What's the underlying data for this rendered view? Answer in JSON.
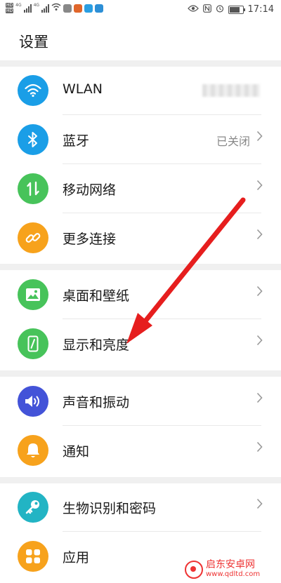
{
  "colors": {
    "wlan": "#1a9ee7",
    "bluetooth": "#1a9ee7",
    "mobile": "#47c35a",
    "more": "#f7a21c",
    "wallpaper": "#47c35a",
    "display": "#47c35a",
    "sound": "#4353d8",
    "notify": "#f7a21c",
    "bio": "#22b4c4",
    "apps": "#f7a21c",
    "arrow": "#e61e1e"
  },
  "status": {
    "hd1": "HD",
    "hd2": "HD",
    "gen1": "4G",
    "gen2": "4G",
    "time": "17:14",
    "battery_level": 0.85
  },
  "page": {
    "title": "设置"
  },
  "rows": [
    {
      "label": "WLAN",
      "value": "",
      "icon": "wifi-icon"
    },
    {
      "label": "蓝牙",
      "value": "已关闭",
      "icon": "bluetooth-icon"
    },
    {
      "label": "移动网络",
      "value": "",
      "icon": "mobile-data-icon"
    },
    {
      "label": "更多连接",
      "value": "",
      "icon": "link-icon"
    },
    {
      "label": "桌面和壁纸",
      "value": "",
      "icon": "image-icon"
    },
    {
      "label": "显示和亮度",
      "value": "",
      "icon": "display-icon"
    },
    {
      "label": "声音和振动",
      "value": "",
      "icon": "speaker-icon"
    },
    {
      "label": "通知",
      "value": "",
      "icon": "bell-icon"
    },
    {
      "label": "生物识别和密码",
      "value": "",
      "icon": "key-icon"
    },
    {
      "label": "应用",
      "value": "",
      "icon": "apps-grid-icon"
    }
  ],
  "watermark": {
    "title": "启东安卓网",
    "url": "www.qdltd.com"
  }
}
